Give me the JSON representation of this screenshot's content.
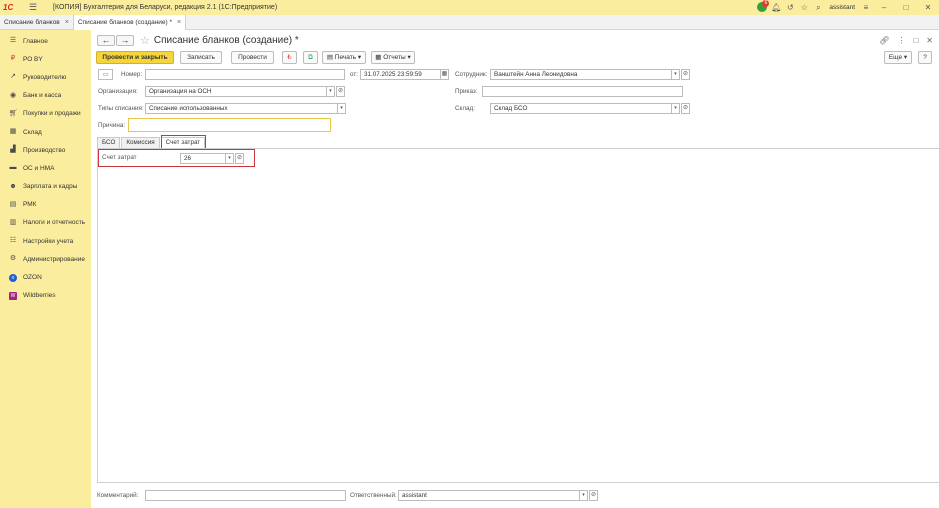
{
  "titlebar": {
    "logo": "1С",
    "title": "[КОПИЯ] Бухгалтерия для Беларуси, редакция 2.1  (1С:Предприятие)",
    "notifications_count": "6",
    "username": "assistant"
  },
  "tabs": [
    {
      "label": "Списание бланков"
    },
    {
      "label": "Списание бланков (создание) *"
    }
  ],
  "sidebar": {
    "items": [
      {
        "label": "Главное",
        "icon": "menu-icon"
      },
      {
        "label": "РО BY",
        "icon": "ruble-icon"
      },
      {
        "label": "Руководителю",
        "icon": "chart-icon"
      },
      {
        "label": "Банк и касса",
        "icon": "bank-icon"
      },
      {
        "label": "Покупки и продажи",
        "icon": "cart-icon"
      },
      {
        "label": "Склад",
        "icon": "warehouse-icon"
      },
      {
        "label": "Производство",
        "icon": "factory-icon"
      },
      {
        "label": "ОС и НМА",
        "icon": "truck-icon"
      },
      {
        "label": "Зарплата и кадры",
        "icon": "people-icon"
      },
      {
        "label": "РМК",
        "icon": "register-icon"
      },
      {
        "label": "Налоги и отчетность",
        "icon": "tax-icon"
      },
      {
        "label": "Настройки учета",
        "icon": "settings-list-icon"
      },
      {
        "label": "Администрирование",
        "icon": "gear-icon"
      },
      {
        "label": "OZON",
        "icon": "ozon-icon"
      },
      {
        "label": "Wildberries",
        "icon": "wildberries-icon"
      }
    ]
  },
  "document": {
    "title": "Списание бланков (создание) *",
    "more_label": "Еще",
    "help_label": "?"
  },
  "toolbar": {
    "post_close": "Провести и закрыть",
    "save": "Записать",
    "post": "Провести",
    "print": "Печать",
    "reports": "Отчеты"
  },
  "form": {
    "number_label": "Номер:",
    "number_value": "",
    "date_label": "от:",
    "date_value": "31.07.2025 23:59:59",
    "employee_label": "Сотрудник:",
    "employee_value": "Ванштейн Анна Леонидовна",
    "org_label": "Организация:",
    "org_value": "Организация на ОСН",
    "order_label": "Приказ:",
    "order_value": "",
    "writeoff_label": "Типы списания:",
    "writeoff_value": "Списание использованных",
    "warehouse_label": "Склад:",
    "warehouse_value": "Склад БСО",
    "reason_label": "Причина:",
    "reason_value": ""
  },
  "form_tabs": [
    {
      "label": "БСО"
    },
    {
      "label": "Комиссия"
    },
    {
      "label": "Счет затрат"
    }
  ],
  "cost_account": {
    "label": "Счет затрат",
    "value": "26"
  },
  "footer": {
    "comment_label": "Комментарий:",
    "comment_value": "",
    "responsible_label": "Ответственный:",
    "responsible_value": "assistant"
  }
}
